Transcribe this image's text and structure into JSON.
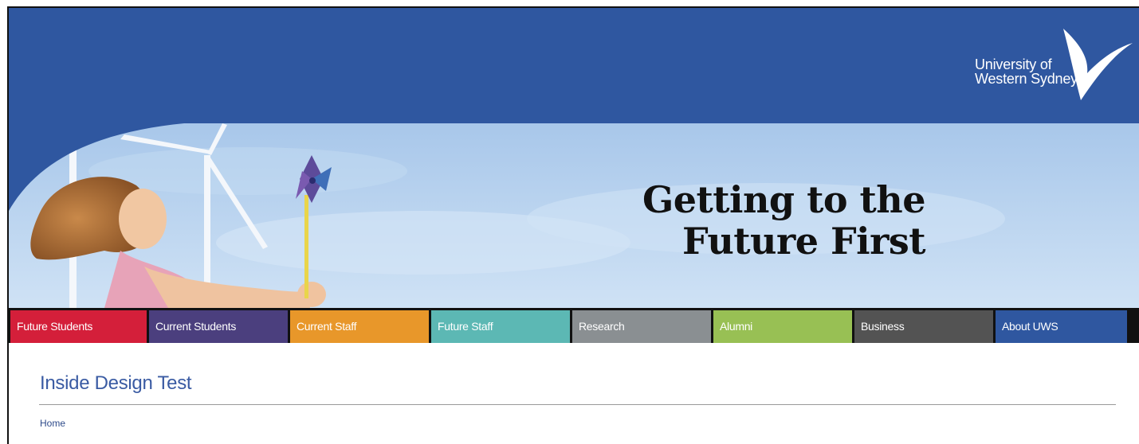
{
  "header": {
    "logo": {
      "line1": "University of",
      "line2": "Western Sydney",
      "icon": "uws-bird-icon"
    },
    "banner": {
      "headline_line1": "Getting to the",
      "headline_line2": "Future First",
      "image": "girl-with-pinwheel-and-wind-turbines"
    }
  },
  "nav": {
    "items": [
      {
        "label": "Future Students",
        "color": "#d41f3a"
      },
      {
        "label": "Current Students",
        "color": "#4b3f7e"
      },
      {
        "label": "Current Staff",
        "color": "#e8972a"
      },
      {
        "label": "Future Staff",
        "color": "#5cb8b4"
      },
      {
        "label": "Research",
        "color": "#8a8f92"
      },
      {
        "label": "Alumni",
        "color": "#98c054"
      },
      {
        "label": "Business",
        "color": "#535353"
      },
      {
        "label": "About UWS",
        "color": "#2f57a0"
      }
    ]
  },
  "main": {
    "title": "Inside Design Test",
    "breadcrumb": "Home"
  },
  "colors": {
    "masthead": "#2f57a0",
    "title": "#3a5ba3"
  }
}
